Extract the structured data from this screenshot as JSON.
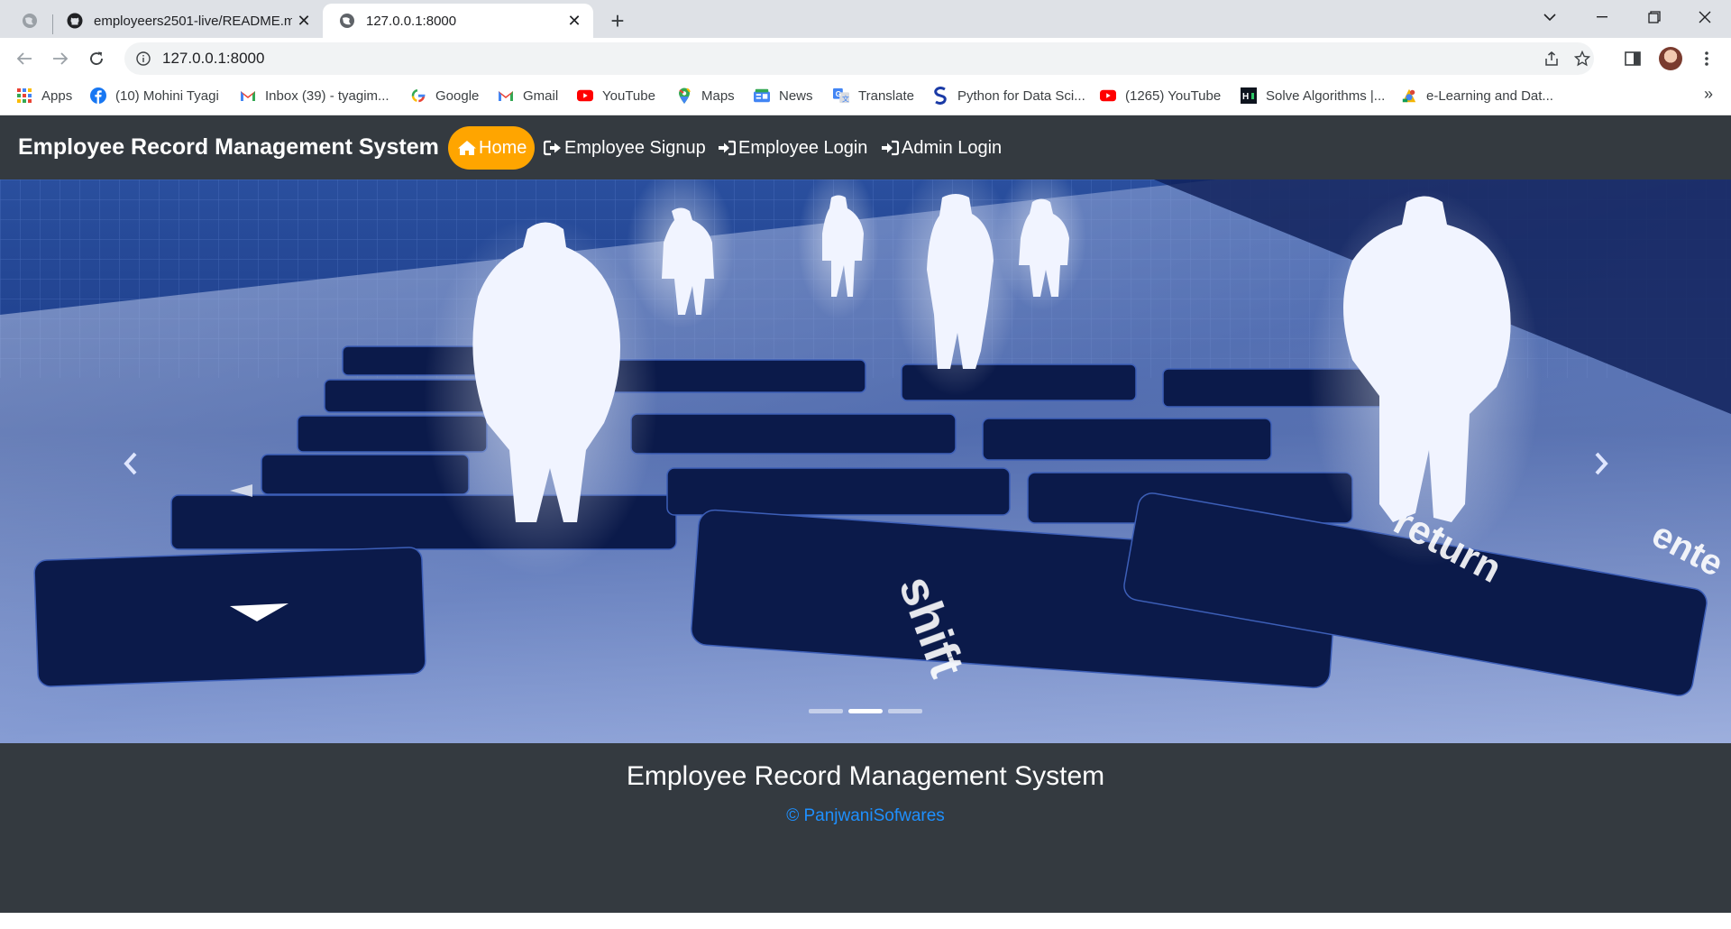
{
  "browser": {
    "tabs": [
      {
        "title": "employeers2501-live/README.m",
        "icon": "github-icon",
        "active": false
      },
      {
        "title": "127.0.0.1:8000",
        "icon": "globe-icon",
        "active": true
      }
    ],
    "new_tab_symbol": "+",
    "address": "127.0.0.1:8000",
    "bookmarks": [
      {
        "label": "Apps",
        "icon": "apps-grid-icon"
      },
      {
        "label": "(10) Mohini Tyagi",
        "icon": "facebook-icon"
      },
      {
        "label": "Inbox (39) - tyagim...",
        "icon": "gmail-icon"
      },
      {
        "label": "Google",
        "icon": "google-icon"
      },
      {
        "label": "Gmail",
        "icon": "gmail-icon"
      },
      {
        "label": "YouTube",
        "icon": "youtube-icon"
      },
      {
        "label": "Maps",
        "icon": "maps-pin-icon"
      },
      {
        "label": "News",
        "icon": "news-icon"
      },
      {
        "label": "Translate",
        "icon": "translate-icon"
      },
      {
        "label": "Python for Data Sci...",
        "icon": "scaler-icon"
      },
      {
        "label": "(1265) YouTube",
        "icon": "youtube-icon"
      },
      {
        "label": "Solve Algorithms |...",
        "icon": "hackerrank-icon"
      },
      {
        "label": "e-Learning and Dat...",
        "icon": "elearning-icon"
      }
    ]
  },
  "site": {
    "brand": "Employee Record Management System",
    "nav": [
      {
        "label": "Home",
        "icon": "home-icon",
        "active": true
      },
      {
        "label": "Employee Signup",
        "icon": "signup-icon",
        "active": false
      },
      {
        "label": "Employee Login",
        "icon": "login-icon",
        "active": false
      },
      {
        "label": "Admin Login",
        "icon": "login-icon",
        "active": false
      }
    ],
    "carousel": {
      "slide_count": 3,
      "active_index": 1,
      "key_labels": {
        "shift": "shift",
        "return": "return",
        "enter": "ente"
      }
    },
    "footer": {
      "title": "Employee Record Management System",
      "copyright": "© PanjwaniSofwares"
    }
  },
  "colors": {
    "navbar_bg": "#343a40",
    "home_pill": "#ffa500",
    "footer_link": "#1e90ff",
    "chrome_tabstrip": "#dee1e6"
  }
}
